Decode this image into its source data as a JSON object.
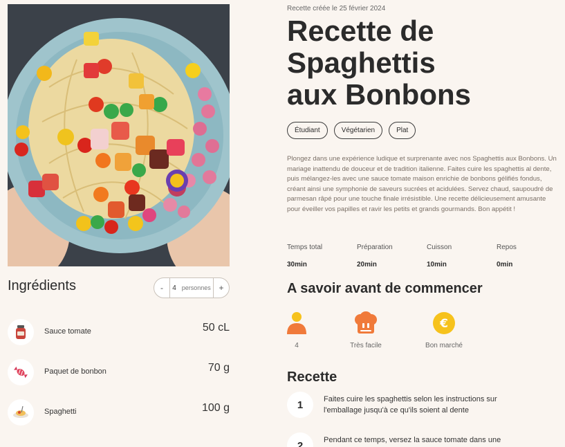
{
  "ingredients_section": {
    "title": "Ingrédients",
    "servings": {
      "minus": "-",
      "quantity": "4",
      "unit": "personnes",
      "plus": "+"
    },
    "items": [
      {
        "name": "Sauce tomate",
        "quantity": "50 cL",
        "icon": "tomato-sauce-jar-icon"
      },
      {
        "name": "Paquet de bonbon",
        "quantity": "70 g",
        "icon": "candy-icon"
      },
      {
        "name": "Spaghetti",
        "quantity": "100 g",
        "icon": "spaghetti-plate-icon"
      }
    ]
  },
  "recipe": {
    "created": "Recette créée le 25 février 2024",
    "title": [
      "Recette de",
      "Spaghettis",
      "aux Bonbons"
    ],
    "tags": [
      "Étudiant",
      "Végétarien",
      "Plat"
    ],
    "description": "Plongez dans une expérience ludique et surprenante avec nos Spaghettis aux Bonbons. Un mariage inattendu de douceur et de tradition italienne. Faites cuire les spaghettis al dente, puis mélangez-les avec une sauce tomate maison enrichie de bonbons gélifiés fondus, créant ainsi une symphonie de saveurs sucrées et acidulées. Servez chaud, saupoudré de parmesan râpé pour une touche finale irrésistible. Une recette délicieusement amusante pour éveiller vos papilles et ravir les petits et grands gourmands. Bon appétit !",
    "times": [
      {
        "label": "Temps total",
        "value": "30min"
      },
      {
        "label": "Préparation",
        "value": "20min"
      },
      {
        "label": "Cuisson",
        "value": "10min"
      },
      {
        "label": "Repos",
        "value": "0min"
      }
    ]
  },
  "know_before": {
    "title": "A savoir avant de commencer",
    "items": [
      {
        "label": "4",
        "icon": "person-icon"
      },
      {
        "label": "Très facile",
        "icon": "chef-hat-icon"
      },
      {
        "label": "Bon marché",
        "icon": "euro-coin-icon"
      }
    ]
  },
  "steps_section": {
    "title": "Recette",
    "steps": [
      {
        "number": "1",
        "text": "Faites cuire les spaghettis selon les instructions sur l'emballage jusqu'à ce qu'ils soient al dente"
      },
      {
        "number": "2",
        "text": "Pendant ce temps, versez la sauce tomate dans une"
      }
    ]
  },
  "colors": {
    "background": "#faf5f0",
    "accent_orange": "#f07a3a",
    "accent_yellow": "#f6c21c"
  }
}
